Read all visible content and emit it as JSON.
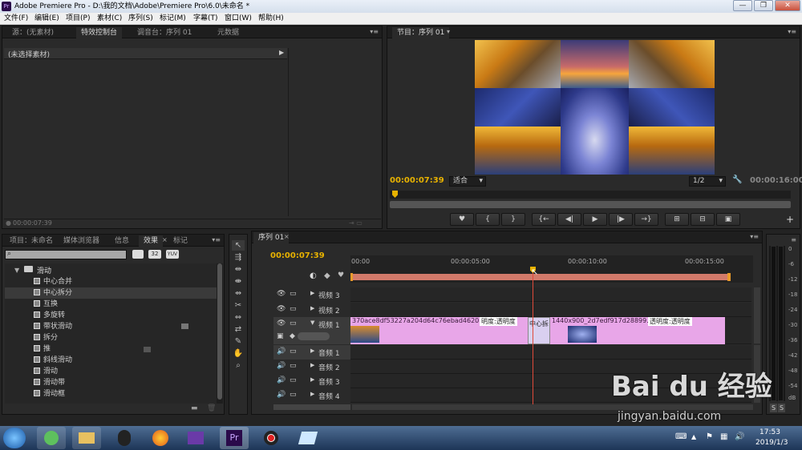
{
  "window": {
    "title": "Adobe Premiere Pro - D:\\我的文档\\Adobe\\Premiere Pro\\6.0\\未命名 *",
    "logo": "Pr",
    "controls": [
      "—",
      "❐",
      "✕"
    ]
  },
  "menu": [
    "文件(F)",
    "编辑(E)",
    "项目(P)",
    "素材(C)",
    "序列(S)",
    "标记(M)",
    "字幕(T)",
    "窗口(W)",
    "帮助(H)"
  ],
  "source_panel": {
    "tabs": [
      "源：(无素材)",
      "特效控制台",
      "调音台：序列 01",
      "元数据"
    ],
    "header": "(未选择素材)",
    "timecode": "00:00:07:39"
  },
  "program_monitor": {
    "tab": "节目：序列 01",
    "timecode": "00:00:07:39",
    "fit": "适合",
    "resolution": "1/2",
    "duration": "00:00:16:00"
  },
  "project_panel": {
    "tabs": [
      "项目：未命名",
      "媒体浏览器",
      "信息",
      "效果",
      "标记"
    ],
    "search_placeholder": "",
    "badges": [
      "32",
      "YUV"
    ],
    "folder": "滑动",
    "effects": [
      "中心合并",
      "中心拆分",
      "互换",
      "多旋转",
      "带状滑动",
      "拆分",
      "推",
      "斜线滑动",
      "滑动",
      "滑动带",
      "滑动框"
    ]
  },
  "timeline": {
    "tab": "序列 01",
    "timecode": "00:00:07:39",
    "ruler": [
      "00:00",
      "00:00:05:00",
      "00:00:10:00",
      "00:00:15:00"
    ],
    "video_tracks": [
      "视频 3",
      "视频 2",
      "视频 1"
    ],
    "audio_tracks": [
      "音频 1",
      "音频 2",
      "音频 3",
      "音频 4"
    ],
    "clip1": "370ace8df53227a204d64c76ebad4620.jpg",
    "clip1_fx": "明度:透明度",
    "transition": "中心拆",
    "clip2": "1440x900_2d7edf917d28899.jpg",
    "clip2_fx": "透明度:透明度"
  },
  "audio_meter": {
    "scale": [
      "0",
      "-6",
      "-12",
      "-18",
      "-24",
      "-30",
      "-36",
      "-42",
      "-48",
      "-54",
      "dB"
    ],
    "solo": [
      "S",
      "S"
    ]
  },
  "taskbar": {
    "time": "17:53",
    "date": "2019/1/3"
  },
  "watermark": {
    "brand": "Bai du 经验",
    "url": "jingyan.baidu.com"
  }
}
